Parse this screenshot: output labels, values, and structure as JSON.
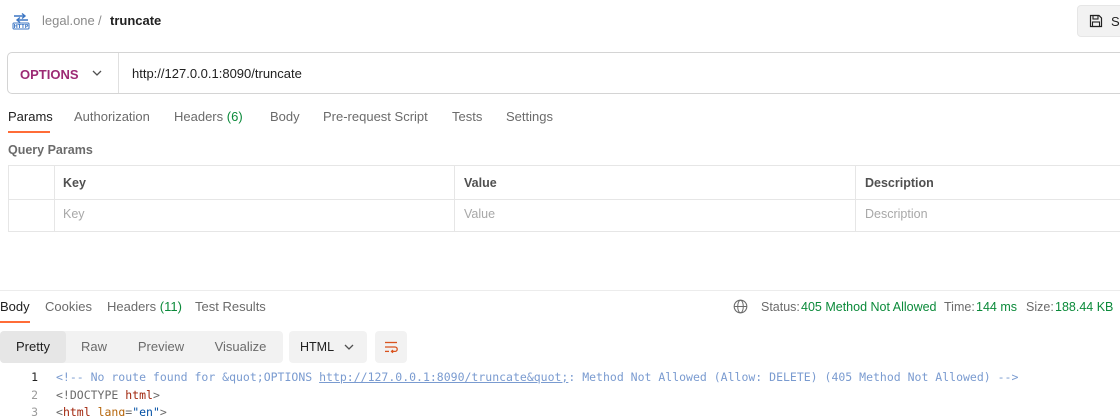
{
  "header": {
    "icon": "http-icon",
    "breadcrumb_parent": "legal.one",
    "breadcrumb_sep": "/",
    "breadcrumb_current": "truncate",
    "save_label": "Sa",
    "save_icon": "floppy-disk-icon"
  },
  "request": {
    "method": "OPTIONS",
    "method_color": "#9c2a74",
    "url": "http://127.0.0.1:8090/truncate"
  },
  "tabs": [
    {
      "label": "Params",
      "active": true
    },
    {
      "label": "Authorization"
    },
    {
      "label": "Headers",
      "count": "(6)"
    },
    {
      "label": "Body"
    },
    {
      "label": "Pre-request Script"
    },
    {
      "label": "Tests"
    },
    {
      "label": "Settings"
    }
  ],
  "query_params": {
    "title": "Query Params",
    "columns": [
      "Key",
      "Value",
      "Description"
    ],
    "placeholders": [
      "Key",
      "Value",
      "Description"
    ]
  },
  "response": {
    "tabs": [
      {
        "label": "Body",
        "active": true
      },
      {
        "label": "Cookies"
      },
      {
        "label": "Headers",
        "count": "(11)"
      },
      {
        "label": "Test Results"
      }
    ],
    "status_label": "Status:",
    "status_value": "405 Method Not Allowed",
    "time_label": "Time:",
    "time_value": "144 ms",
    "size_label": "Size:",
    "size_value": "188.44 KB",
    "view_modes": [
      "Pretty",
      "Raw",
      "Preview",
      "Visualize"
    ],
    "active_view": "Pretty",
    "format": "HTML",
    "code_lines": [
      {
        "num": "1",
        "comment_start": "<!-- No route found for &quot;OPTIONS ",
        "link": "http://127.0.0.1:8090/truncate&quot;",
        "comment_end": ": Method Not Allowed (Allow: DELETE) (405 Method Not Allowed) -->"
      },
      {
        "num": "2",
        "text": "<!DOCTYPE ",
        "tag": "html",
        "close": ">"
      },
      {
        "num": "3",
        "open": "<",
        "tag": "html",
        "attr": " lang",
        "eq": "=",
        "str": "\"en\"",
        "close": ">"
      }
    ]
  },
  "colors": {
    "accent": "#ff6c37",
    "success": "#0b8a3a"
  }
}
